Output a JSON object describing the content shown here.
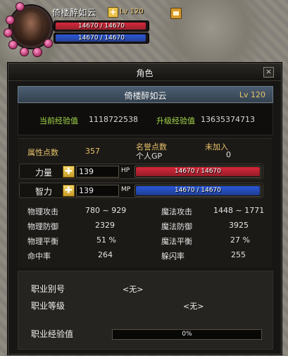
{
  "hud": {
    "name": "倚楼醉如云",
    "level": "Lv 120",
    "hp": {
      "text": "14670 / 14670",
      "fraction": 1.0,
      "color": "#d8283a"
    },
    "mp": {
      "text": "14670 / 14670",
      "fraction": 1.0,
      "color": "#2a58d8"
    },
    "plus_icon": "plus-icon",
    "slot_icon": "bag-icon"
  },
  "panel": {
    "title": "角色",
    "close_glyph": "×",
    "name_bar": {
      "name": "倚楼醉如云",
      "level": "Lv 120"
    },
    "exp": {
      "current_label": "当前经验值",
      "current_value": "1118722538",
      "next_label": "升级经验值",
      "next_value": "13635374713"
    },
    "attr": {
      "points_label": "属性点数",
      "points_value": "357",
      "honor_label": "名誉点数",
      "honor_value": "未加入",
      "personal_gp_label": "个人GP",
      "personal_gp_value": "0",
      "strength": {
        "label": "力量",
        "value": "139",
        "unit": "HP",
        "bar_text": "14670 / 14670",
        "fraction": 1.0,
        "color": "#d8283a"
      },
      "intellect": {
        "label": "智力",
        "value": "139",
        "unit": "MP",
        "bar_text": "14670 / 14670",
        "fraction": 1.0,
        "color": "#2a58d8"
      },
      "plus_glyph": "✚"
    },
    "stats": [
      {
        "label": "物理攻击",
        "value": "780 ~ 929",
        "label2": "魔法攻击",
        "value2": "1448 ~ 1771"
      },
      {
        "label": "物理防御",
        "value": "2329",
        "label2": "魔法防御",
        "value2": "3925"
      },
      {
        "label": "物理平衡",
        "value": "51 %",
        "label2": "魔法平衡",
        "value2": "27 %"
      },
      {
        "label": "命中率",
        "value": "264",
        "label2": "躲闪率",
        "value2": "255"
      }
    ],
    "job": {
      "alias_label": "职业别号",
      "alias_value": "<无>",
      "level_label": "职业等级",
      "level_value": "<无>",
      "exp_label": "职业经验值",
      "exp_text": "0%",
      "exp_fraction": 0.0
    }
  }
}
